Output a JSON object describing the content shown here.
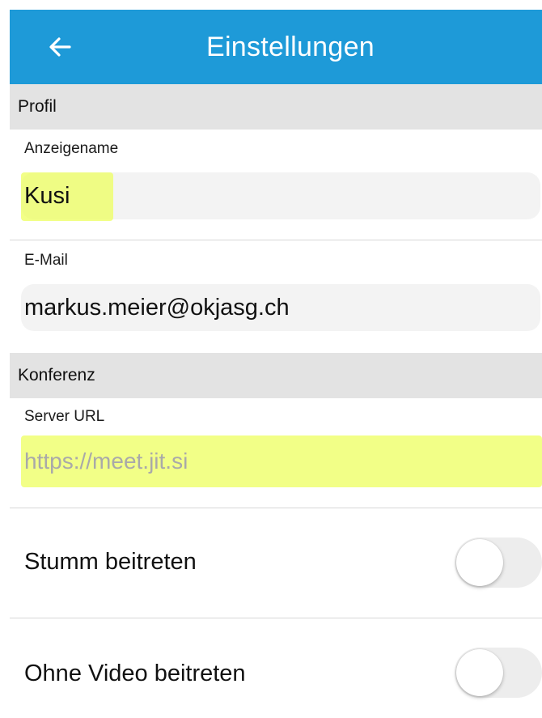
{
  "header": {
    "title": "Einstellungen",
    "background": "#1e9ad8",
    "back_icon": "arrow-left-icon"
  },
  "sections": {
    "profile": {
      "title": "Profil",
      "display_name_label": "Anzeigename",
      "display_name_value": "Kusi",
      "email_label": "E-Mail",
      "email_value": "markus.meier@okjasg.ch"
    },
    "conference": {
      "title": "Konferenz",
      "server_url_label": "Server URL",
      "server_url_placeholder": "https://meet.jit.si",
      "join_muted_label": "Stumm beitreten",
      "join_muted_on": false,
      "join_no_video_label": "Ohne Video beitreten",
      "join_no_video_on": false
    }
  },
  "colors": {
    "highlight": "#eeff5f",
    "section_bg": "#e3e3e3",
    "input_bg": "#f3f3f3"
  }
}
